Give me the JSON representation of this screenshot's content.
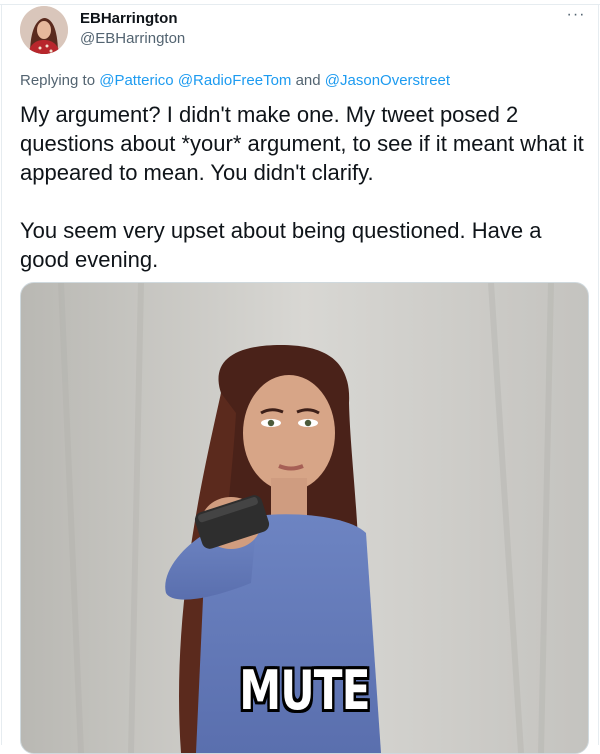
{
  "tweet": {
    "display_name": "EBHarrington",
    "handle": "@EBHarrington",
    "more_icon": "more-options-icon",
    "replying_prefix": "Replying to",
    "mentions": [
      "@Patterico",
      "@RadioFreeTom",
      "@JasonOverstreet"
    ],
    "mentions_joiner": "and",
    "paragraphs": [
      "My argument? I didn't make one. My tweet posed 2 questions about *your* argument, to see if it meant what it appeared to mean. You didn't clarify.",
      "You seem very upset about being questioned. Have a good evening."
    ],
    "media": {
      "caption": "MUTE"
    }
  },
  "colors": {
    "link": "#1d9bf0",
    "secondary_text": "#536471",
    "primary_text": "#0f1419",
    "border": "#cfd9de"
  }
}
